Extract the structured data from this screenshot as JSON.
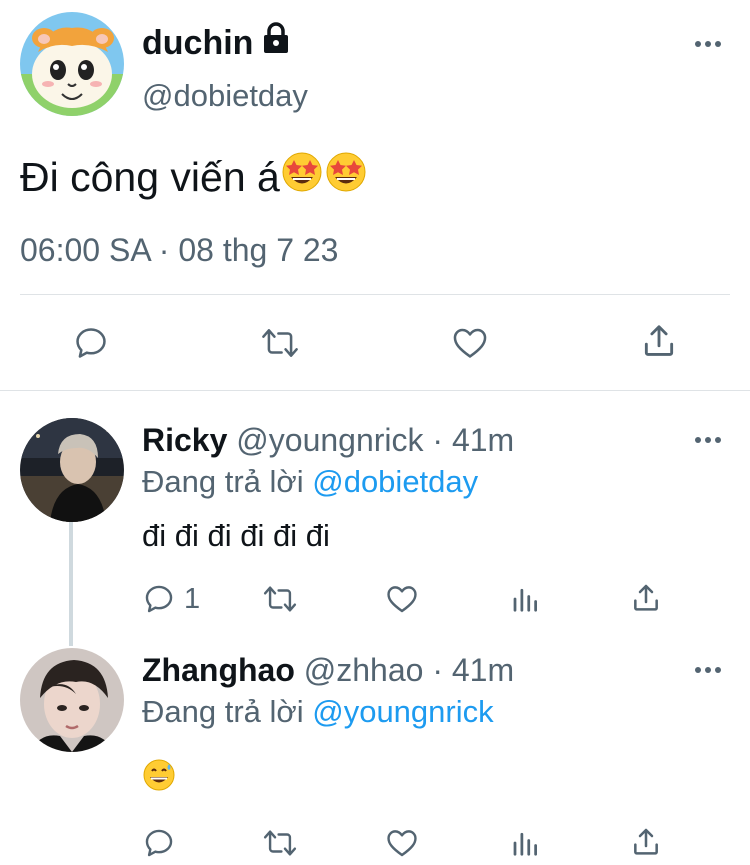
{
  "main_tweet": {
    "display_name": "duchin",
    "handle": "@dobietday",
    "text": "Đi công viến á",
    "emojis": [
      "star-struck",
      "star-struck"
    ],
    "timestamp": "06:00 SA · 08 thg 7 23",
    "actions": [
      "reply-icon",
      "retweet-icon",
      "like-icon",
      "share-icon"
    ]
  },
  "replies": [
    {
      "display_name": "Ricky",
      "handle_meta": " @youngnrick · 41m",
      "replying_label": "Đang trả lời ",
      "replying_to": "@dobietday",
      "text": "đi đi đi đi đi đi",
      "reply_count": "1"
    },
    {
      "display_name": "Zhanghao",
      "handle_meta": " @zhhao · 41m",
      "replying_label": "Đang trả lời ",
      "replying_to": "@youngnrick",
      "emoji": "grinning-sweat",
      "reply_count": ""
    }
  ],
  "colors": {
    "text": "#0f1419",
    "secondary": "#536471",
    "link": "#1d9bf0",
    "divider": "#dfe3e6"
  }
}
